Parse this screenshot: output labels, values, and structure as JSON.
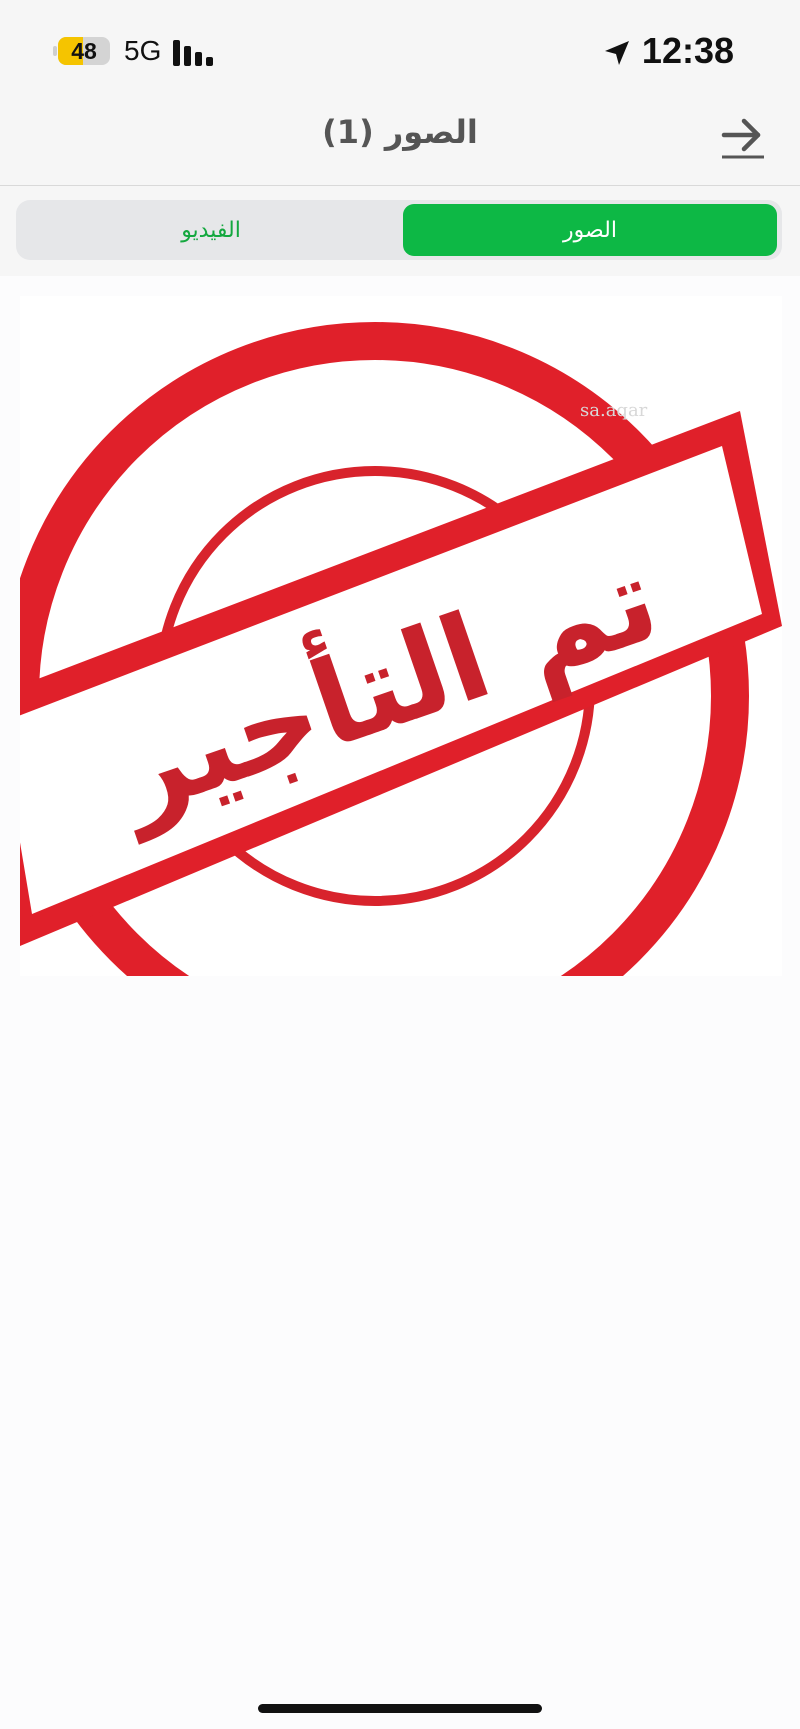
{
  "status_bar": {
    "battery_level": "48",
    "battery_fraction": 0.48,
    "battery_color": "#f5c400",
    "network": "5G",
    "time": "12:38",
    "signal_icon": "signal-bars-icon",
    "location_icon": "location-arrow-icon"
  },
  "header": {
    "title": "الصور (1)",
    "back_icon": "arrow-right-icon"
  },
  "tabs": [
    {
      "label": "الصور",
      "active": true
    },
    {
      "label": "الفيديو",
      "active": false
    }
  ],
  "colors": {
    "accent": "#0db845",
    "inactive_tab_text": "#14a83f",
    "stamp_red": "#e0202a"
  },
  "photo": {
    "stamp_text": "تم التأجير",
    "watermark": "sa.aqar"
  }
}
